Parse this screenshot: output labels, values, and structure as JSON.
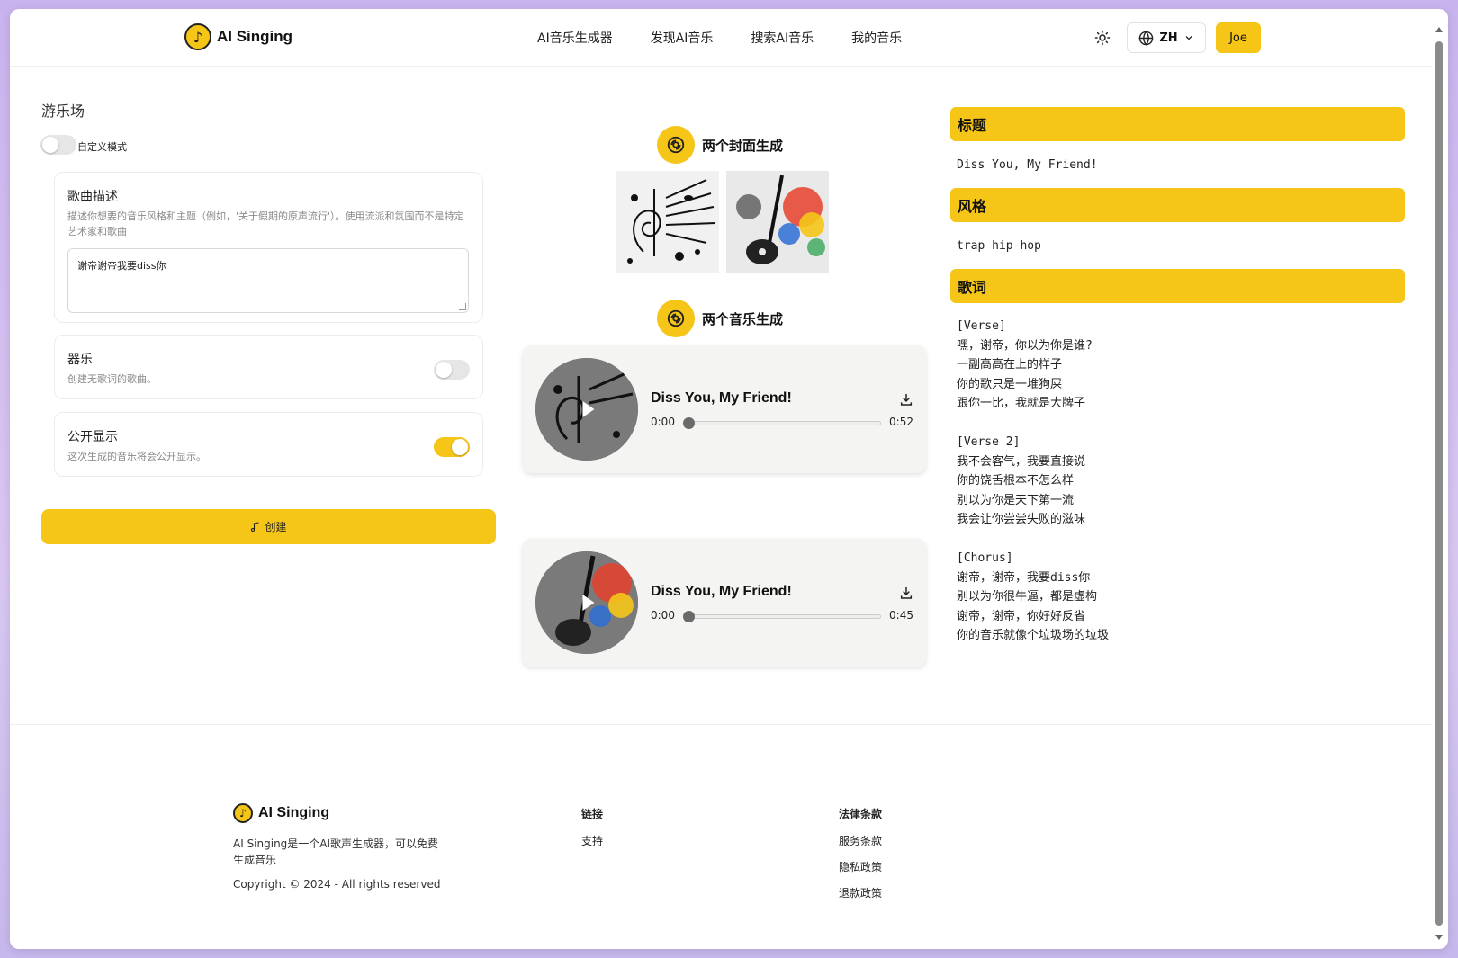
{
  "header": {
    "brand": "AI Singing",
    "nav": [
      "AI音乐生成器",
      "发现AI音乐",
      "搜索AI音乐",
      "我的音乐"
    ],
    "lang": "ZH",
    "user": "Joe"
  },
  "form": {
    "title": "游乐场",
    "custom_mode_label": "自定义模式",
    "custom_mode_on": false,
    "song_desc_title": "歌曲描述",
    "song_desc_hint": "描述你想要的音乐风格和主题（例如，'关于假期的原声流行'）。使用流派和氛围而不是特定艺术家和歌曲",
    "song_desc_value": "谢帝谢帝我要diss你",
    "instrumental_title": "器乐",
    "instrumental_desc": "创建无歌词的歌曲。",
    "instrumental_on": false,
    "public_title": "公开显示",
    "public_desc": "这次生成的音乐将会公开显示。",
    "public_on": true,
    "create_label": "创建"
  },
  "results": {
    "covers_title": "两个封面生成",
    "music_title": "两个音乐生成",
    "tracks": [
      {
        "title": "Diss You, My Friend!",
        "current": "0:00",
        "duration": "0:52",
        "progress": 0
      },
      {
        "title": "Diss You, My Friend!",
        "current": "0:00",
        "duration": "0:45",
        "progress": 0
      }
    ]
  },
  "details": {
    "title_header": "标题",
    "title_value": "Diss You, My Friend!",
    "style_header": "风格",
    "style_value": "trap hip-hop",
    "lyrics_header": "歌词",
    "lyrics": "[Verse]\n嘿，谢帝，你以为你是谁?\n一副高高在上的样子\n你的歌只是一堆狗屎\n跟你一比，我就是大牌子\n\n[Verse 2]\n我不会客气，我要直接说\n你的饶舌根本不怎么样\n别以为你是天下第一流\n我会让你尝尝失败的滋味\n\n[Chorus]\n谢帝，谢帝，我要diss你\n别以为你很牛逼，都是虚构\n谢帝，谢帝，你好好反省\n你的音乐就像个垃圾场的垃圾"
  },
  "footer": {
    "brand": "AI Singing",
    "desc": "AI Singing是一个AI歌声生成器，可以免费生成音乐",
    "copyright": "Copyright © 2024 - All rights reserved",
    "links_header": "链接",
    "links": [
      "支持"
    ],
    "legal_header": "法律条款",
    "legal": [
      "服务条款",
      "隐私政策",
      "退款政策"
    ]
  },
  "colors": {
    "accent": "#f5c518"
  }
}
